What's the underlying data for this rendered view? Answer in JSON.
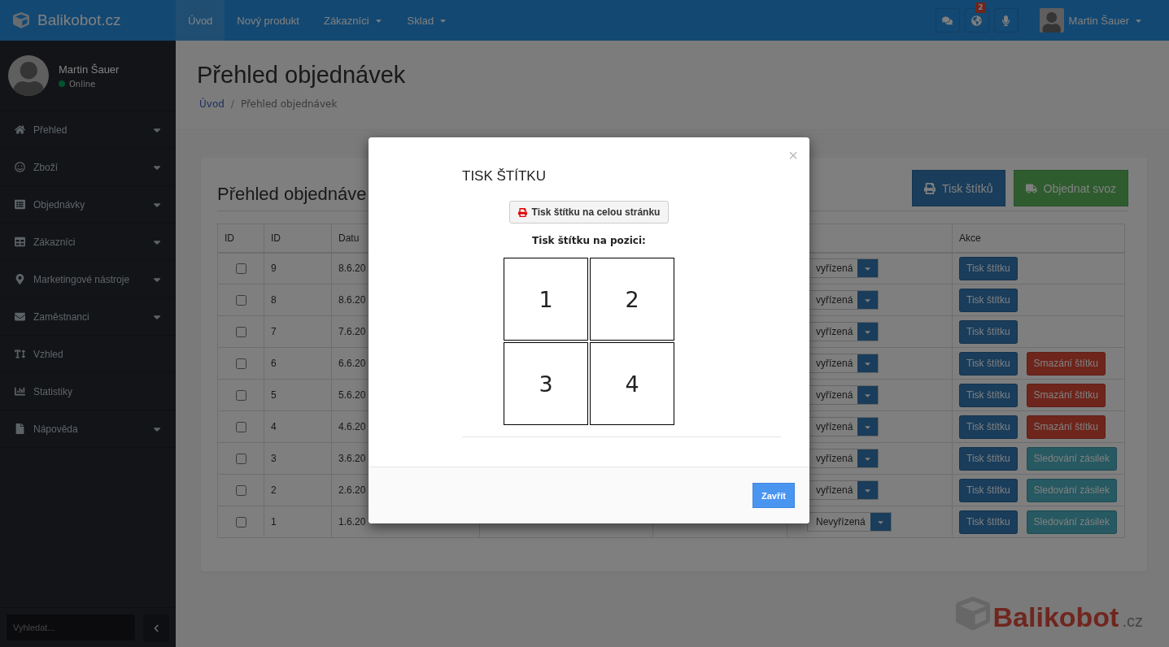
{
  "topbar": {
    "brand": "Balikobot.cz",
    "nav": [
      {
        "label": "Úvod",
        "selected": true,
        "dropdown": false
      },
      {
        "label": "Nový produkt",
        "selected": false,
        "dropdown": false
      },
      {
        "label": "Zákazníci",
        "selected": false,
        "dropdown": true
      },
      {
        "label": "Sklad",
        "selected": false,
        "dropdown": true
      }
    ],
    "notification_badge": "2",
    "user_name": "Martin Šauer"
  },
  "sidebar": {
    "user": {
      "name": "Martin Šauer",
      "status": "Online"
    },
    "menu": [
      {
        "label": "Přehled",
        "expandable": true
      },
      {
        "label": "Zboží",
        "expandable": true
      },
      {
        "label": "Objednávky",
        "expandable": true
      },
      {
        "label": "Zákazníci",
        "expandable": true
      },
      {
        "label": "Marketingové nástroje",
        "expandable": true
      },
      {
        "label": "Zaměstnanci",
        "expandable": true
      },
      {
        "label": "Vzhled",
        "expandable": false
      },
      {
        "label": "Statistiky",
        "expandable": false
      },
      {
        "label": "Nápověda",
        "expandable": true
      }
    ],
    "search": {
      "placeholder": "Vyhledat..."
    }
  },
  "page": {
    "title": "Přehled objednávek",
    "breadcrumb": [
      "Úvod",
      "Přehled objednávek"
    ],
    "breadcrumb_separator": "/"
  },
  "card": {
    "title": "Přehled objednáve",
    "buttons": [
      {
        "label": "Tisk štítků",
        "kind": "print"
      },
      {
        "label": "Objednat svoz",
        "kind": "pickup"
      }
    ],
    "columns": [
      "ID",
      "ID",
      "Datu"
    ],
    "columns_right": [
      "Akce"
    ],
    "rows": [
      {
        "checked": false,
        "id": "9",
        "date": "8.6.20",
        "status": "vyřízená",
        "actions": [
          {
            "label": "Tisk štítku",
            "kind": "print"
          }
        ]
      },
      {
        "checked": false,
        "id": "8",
        "date": "8.6.20",
        "status": "vyřízená",
        "actions": [
          {
            "label": "Tisk štítku",
            "kind": "print"
          }
        ]
      },
      {
        "checked": false,
        "id": "7",
        "date": "7.6.20",
        "status": "vyřízená",
        "actions": [
          {
            "label": "Tisk štítku",
            "kind": "print"
          }
        ]
      },
      {
        "checked": false,
        "id": "6",
        "date": "6.6.20",
        "status": "vyřízená",
        "actions": [
          {
            "label": "Tisk štítku",
            "kind": "print"
          },
          {
            "label": "Smazání štítku",
            "kind": "delete"
          }
        ]
      },
      {
        "checked": false,
        "id": "5",
        "date": "5.6.20",
        "status": "vyřízená",
        "actions": [
          {
            "label": "Tisk štítku",
            "kind": "print"
          },
          {
            "label": "Smazání štítku",
            "kind": "delete"
          }
        ]
      },
      {
        "checked": false,
        "id": "4",
        "date": "4.6.20",
        "status": "vyřízená",
        "actions": [
          {
            "label": "Tisk štítku",
            "kind": "print"
          },
          {
            "label": "Smazání štítku",
            "kind": "delete"
          }
        ]
      },
      {
        "checked": false,
        "id": "3",
        "date": "3.6.20",
        "status": "vyřízená",
        "actions": [
          {
            "label": "Tisk štítku",
            "kind": "print"
          },
          {
            "label": "Sledování zásilek",
            "kind": "track"
          }
        ]
      },
      {
        "checked": false,
        "id": "2",
        "date": "2.6.20",
        "status": "vyřízená",
        "actions": [
          {
            "label": "Tisk štítku",
            "kind": "print"
          },
          {
            "label": "Sledování zásilek",
            "kind": "track"
          }
        ]
      },
      {
        "checked": false,
        "id": "1",
        "date": "1.6.20",
        "status": "Nevyřízená",
        "actions": [
          {
            "label": "Tisk štítku",
            "kind": "print"
          },
          {
            "label": "Sledování zásilek",
            "kind": "track"
          }
        ]
      }
    ]
  },
  "footer_logo": {
    "name": "Balikobot",
    "suffix": ".cz"
  },
  "modal": {
    "title": "TISK ŠTÍTKU",
    "close": "×",
    "full_page_button": "Tisk štítku na celou stránku",
    "position_label": "Tisk štítku na pozici:",
    "positions": [
      "1",
      "2",
      "3",
      "4"
    ],
    "close_button": "Zavřít"
  }
}
